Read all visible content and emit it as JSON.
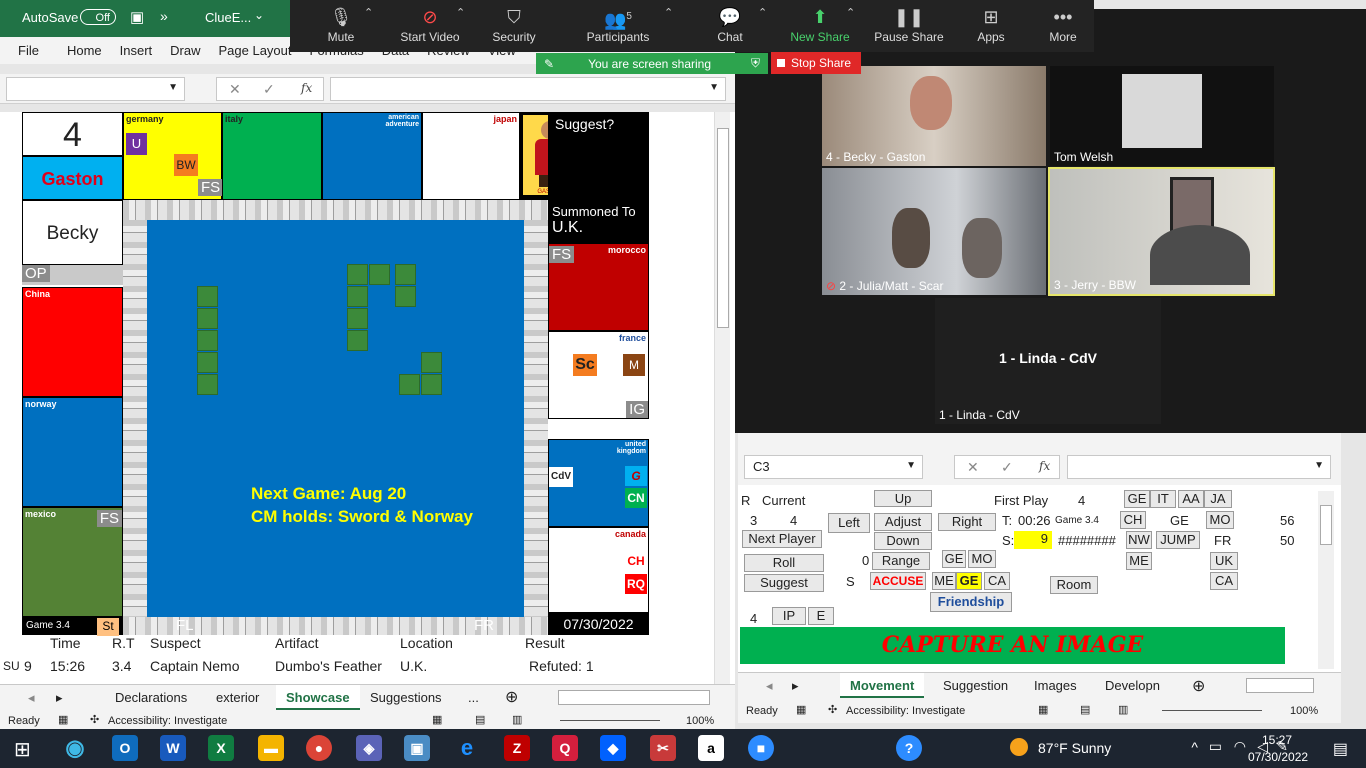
{
  "excel1": {
    "autosave_label": "AutoSave",
    "autosave_state": "Off",
    "file_name": "ClueE...",
    "menu": [
      "File",
      "Home",
      "Insert",
      "Draw",
      "Page Layout",
      "Formulas",
      "Data",
      "Review",
      "View"
    ],
    "fx": "fx",
    "sheet_tabs": [
      "Declarations",
      "exterior",
      "Showcase",
      "Suggestions"
    ],
    "active_tab": "Showcase",
    "status_ready": "Ready",
    "status_accessibility": "Accessibility: Investigate",
    "zoom": "100%",
    "more_tabs": "..."
  },
  "board": {
    "player_number": "4",
    "character": "Gaston",
    "player": "Becky",
    "suggest_prompt": "Suggest?",
    "summoned_label": "Summoned To",
    "summoned_value": "U.K.",
    "portrait_label": "GASTON",
    "countries": {
      "germany": "germany",
      "italy": "italy",
      "american": "american adventure",
      "japan": "japan",
      "morocco": "morocco",
      "france": "france",
      "uk": "united kingdom",
      "canada": "canada",
      "china": "China",
      "norway": "norway",
      "mexico": "mexico"
    },
    "tags": {
      "u": "U",
      "bw": "BW",
      "fs": "FS",
      "op": "OP",
      "sc": "Sc",
      "m": "M",
      "ig": "IG",
      "cdv": "CdV",
      "g": "G",
      "cn": "CN",
      "ch": "CH",
      "rq": "RQ",
      "fl": "FL",
      "fr": "FR",
      "st": "St"
    },
    "game_label": "Game 3.4",
    "date": "07/30/2022",
    "center_line1": "Next Game: Aug 20",
    "center_line2": "CM holds: Sword & Norway"
  },
  "log": {
    "headers": [
      "Time",
      "R.T",
      "Suspect",
      "Artifact",
      "Location",
      "Result"
    ],
    "row": {
      "day": "SU",
      "num": "9",
      "time": "15:26",
      "rt": "3.4",
      "suspect": "Captain Nemo",
      "artifact": "Dumbo's Feather",
      "location": "U.K.",
      "result": "Refuted: 1"
    }
  },
  "zoom": {
    "toolbar": [
      {
        "key": "mute",
        "label": "Mute",
        "icon": "mic-icon"
      },
      {
        "key": "video",
        "label": "Start Video",
        "icon": "video-off-icon"
      },
      {
        "key": "security",
        "label": "Security",
        "icon": "shield-icon"
      },
      {
        "key": "participants",
        "label": "Participants",
        "icon": "people-icon"
      },
      {
        "key": "chat",
        "label": "Chat",
        "icon": "chat-icon"
      },
      {
        "key": "newshare",
        "label": "New Share",
        "icon": "share-icon"
      },
      {
        "key": "pause",
        "label": "Pause Share",
        "icon": "pause-icon"
      },
      {
        "key": "apps",
        "label": "Apps",
        "icon": "apps-icon"
      },
      {
        "key": "more",
        "label": "More",
        "icon": "more-icon"
      }
    ],
    "participant_count": "5",
    "sharing_banner": "You are screen sharing",
    "stop_share": "Stop Share",
    "tiles": [
      "4 - Becky - Gaston",
      "Tom Welsh",
      "2 - Julia/Matt - Scar",
      "3 - Jerry - BBW"
    ],
    "active_speaker": "1 - Linda - CdV",
    "active_speaker_label": "1 - Linda - CdV"
  },
  "excel2": {
    "name_box": "C3",
    "fx": "fx",
    "r_label": "R",
    "current_label": "Current",
    "r_value": "3",
    "current_value": "4",
    "first_play_label": "First Play",
    "first_play_value": "4",
    "timer_label": "T:",
    "timer_value": "00:26",
    "game": "Game 3.4",
    "s_label": "S:",
    "s_value": "9",
    "hashes": "########",
    "zero": "0",
    "s2": "S",
    "buttons": {
      "up": "Up",
      "left": "Left",
      "adjust": "Adjust",
      "right": "Right",
      "down": "Down",
      "next_player": "Next Player",
      "roll": "Roll",
      "range": "Range",
      "suggest": "Suggest",
      "accuse": "ACCUSE",
      "friendship": "Friendship",
      "room": "Room",
      "jump": "JUMP",
      "ip": "IP",
      "e": "E"
    },
    "codes": {
      "ge": "GE",
      "it": "IT",
      "aa": "AA",
      "ja": "JA",
      "ch": "CH",
      "mo": "MO",
      "nw": "NW",
      "fr": "FR",
      "me": "ME",
      "uk": "UK",
      "ca": "CA"
    },
    "num56": "56",
    "num50": "50",
    "four": "4",
    "capture": "CAPTURE AN IMAGE",
    "sheet_tabs": [
      "Movement",
      "Suggestion",
      "Images",
      "Developn"
    ],
    "active_tab": "Movement",
    "status_ready": "Ready",
    "status_accessibility": "Accessibility: Investigate",
    "zoom": "100%"
  },
  "taskbar": {
    "weather": "87°F  Sunny",
    "time": "15:27",
    "date": "07/30/2022"
  },
  "colors": {
    "excel_green": "#217346",
    "board_blue": "#0070c0",
    "zoom_green": "#2da44e",
    "stop_red": "#e02828"
  }
}
